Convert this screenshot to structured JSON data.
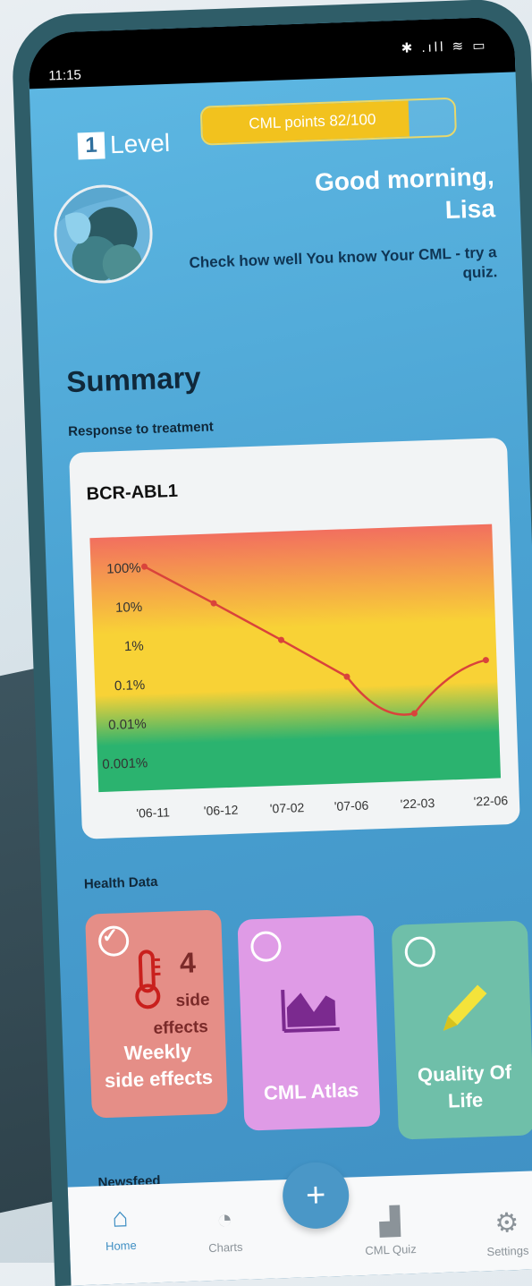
{
  "status_bar": {
    "time": "11:15",
    "icons": "✱ .ıll ≋ ▭"
  },
  "level": {
    "number": "1",
    "label": "Level"
  },
  "points": {
    "label": "CML points 82/100",
    "progress_fraction": 0.82,
    "fill_color": "#f2c21e"
  },
  "greeting": {
    "line1": "Good morning,",
    "line2": "Lisa"
  },
  "hint": "Check how well You know Your CML - try a quiz.",
  "summary_title": "Summary",
  "response_label": "Response to treatment",
  "chart_title": "BCR-ABL1",
  "chart_data": {
    "type": "line",
    "title": "BCR-ABL1",
    "categories": [
      "'06-11",
      "'06-12",
      "'07-02",
      "'07-06",
      "'22-03",
      "'22-06"
    ],
    "y_tick_labels": [
      "100%",
      "10%",
      "1%",
      "0.1%",
      "0.01%",
      "0.001%"
    ],
    "y_scale": "log",
    "series": [
      {
        "values": [
          100,
          10,
          1,
          0.1,
          0.01,
          0.2
        ]
      }
    ],
    "line_color": "#d9433b",
    "background_bands": [
      "#f26f5f",
      "#f8d236",
      "#2bb36f"
    ]
  },
  "health_label": "Health Data",
  "tiles": [
    {
      "title_line1": "Weekly",
      "title_line2": "side effects",
      "count": "4",
      "count_label1": "side",
      "count_label2": "effects",
      "checked": true,
      "icon": "thermometer-icon",
      "color": "#e58e87"
    },
    {
      "title_line1": "CML Atlas",
      "title_line2": "",
      "checked": false,
      "icon": "area-chart-icon",
      "color": "#df9be6"
    },
    {
      "title_line1": "Quality Of",
      "title_line2": "Life",
      "checked": false,
      "icon": "pencil-icon",
      "color": "#6fbfa9"
    }
  ],
  "newsfeed_label": "Newsfeed",
  "nav": [
    {
      "label": "Home",
      "icon": "home-icon",
      "active": true
    },
    {
      "label": "Charts",
      "icon": "pie-chart-icon"
    },
    {
      "label": "+",
      "icon": "plus-icon"
    },
    {
      "label": "CML Quiz",
      "icon": "bar-chart-icon"
    },
    {
      "label": "Settings",
      "icon": "gear-icon"
    }
  ]
}
